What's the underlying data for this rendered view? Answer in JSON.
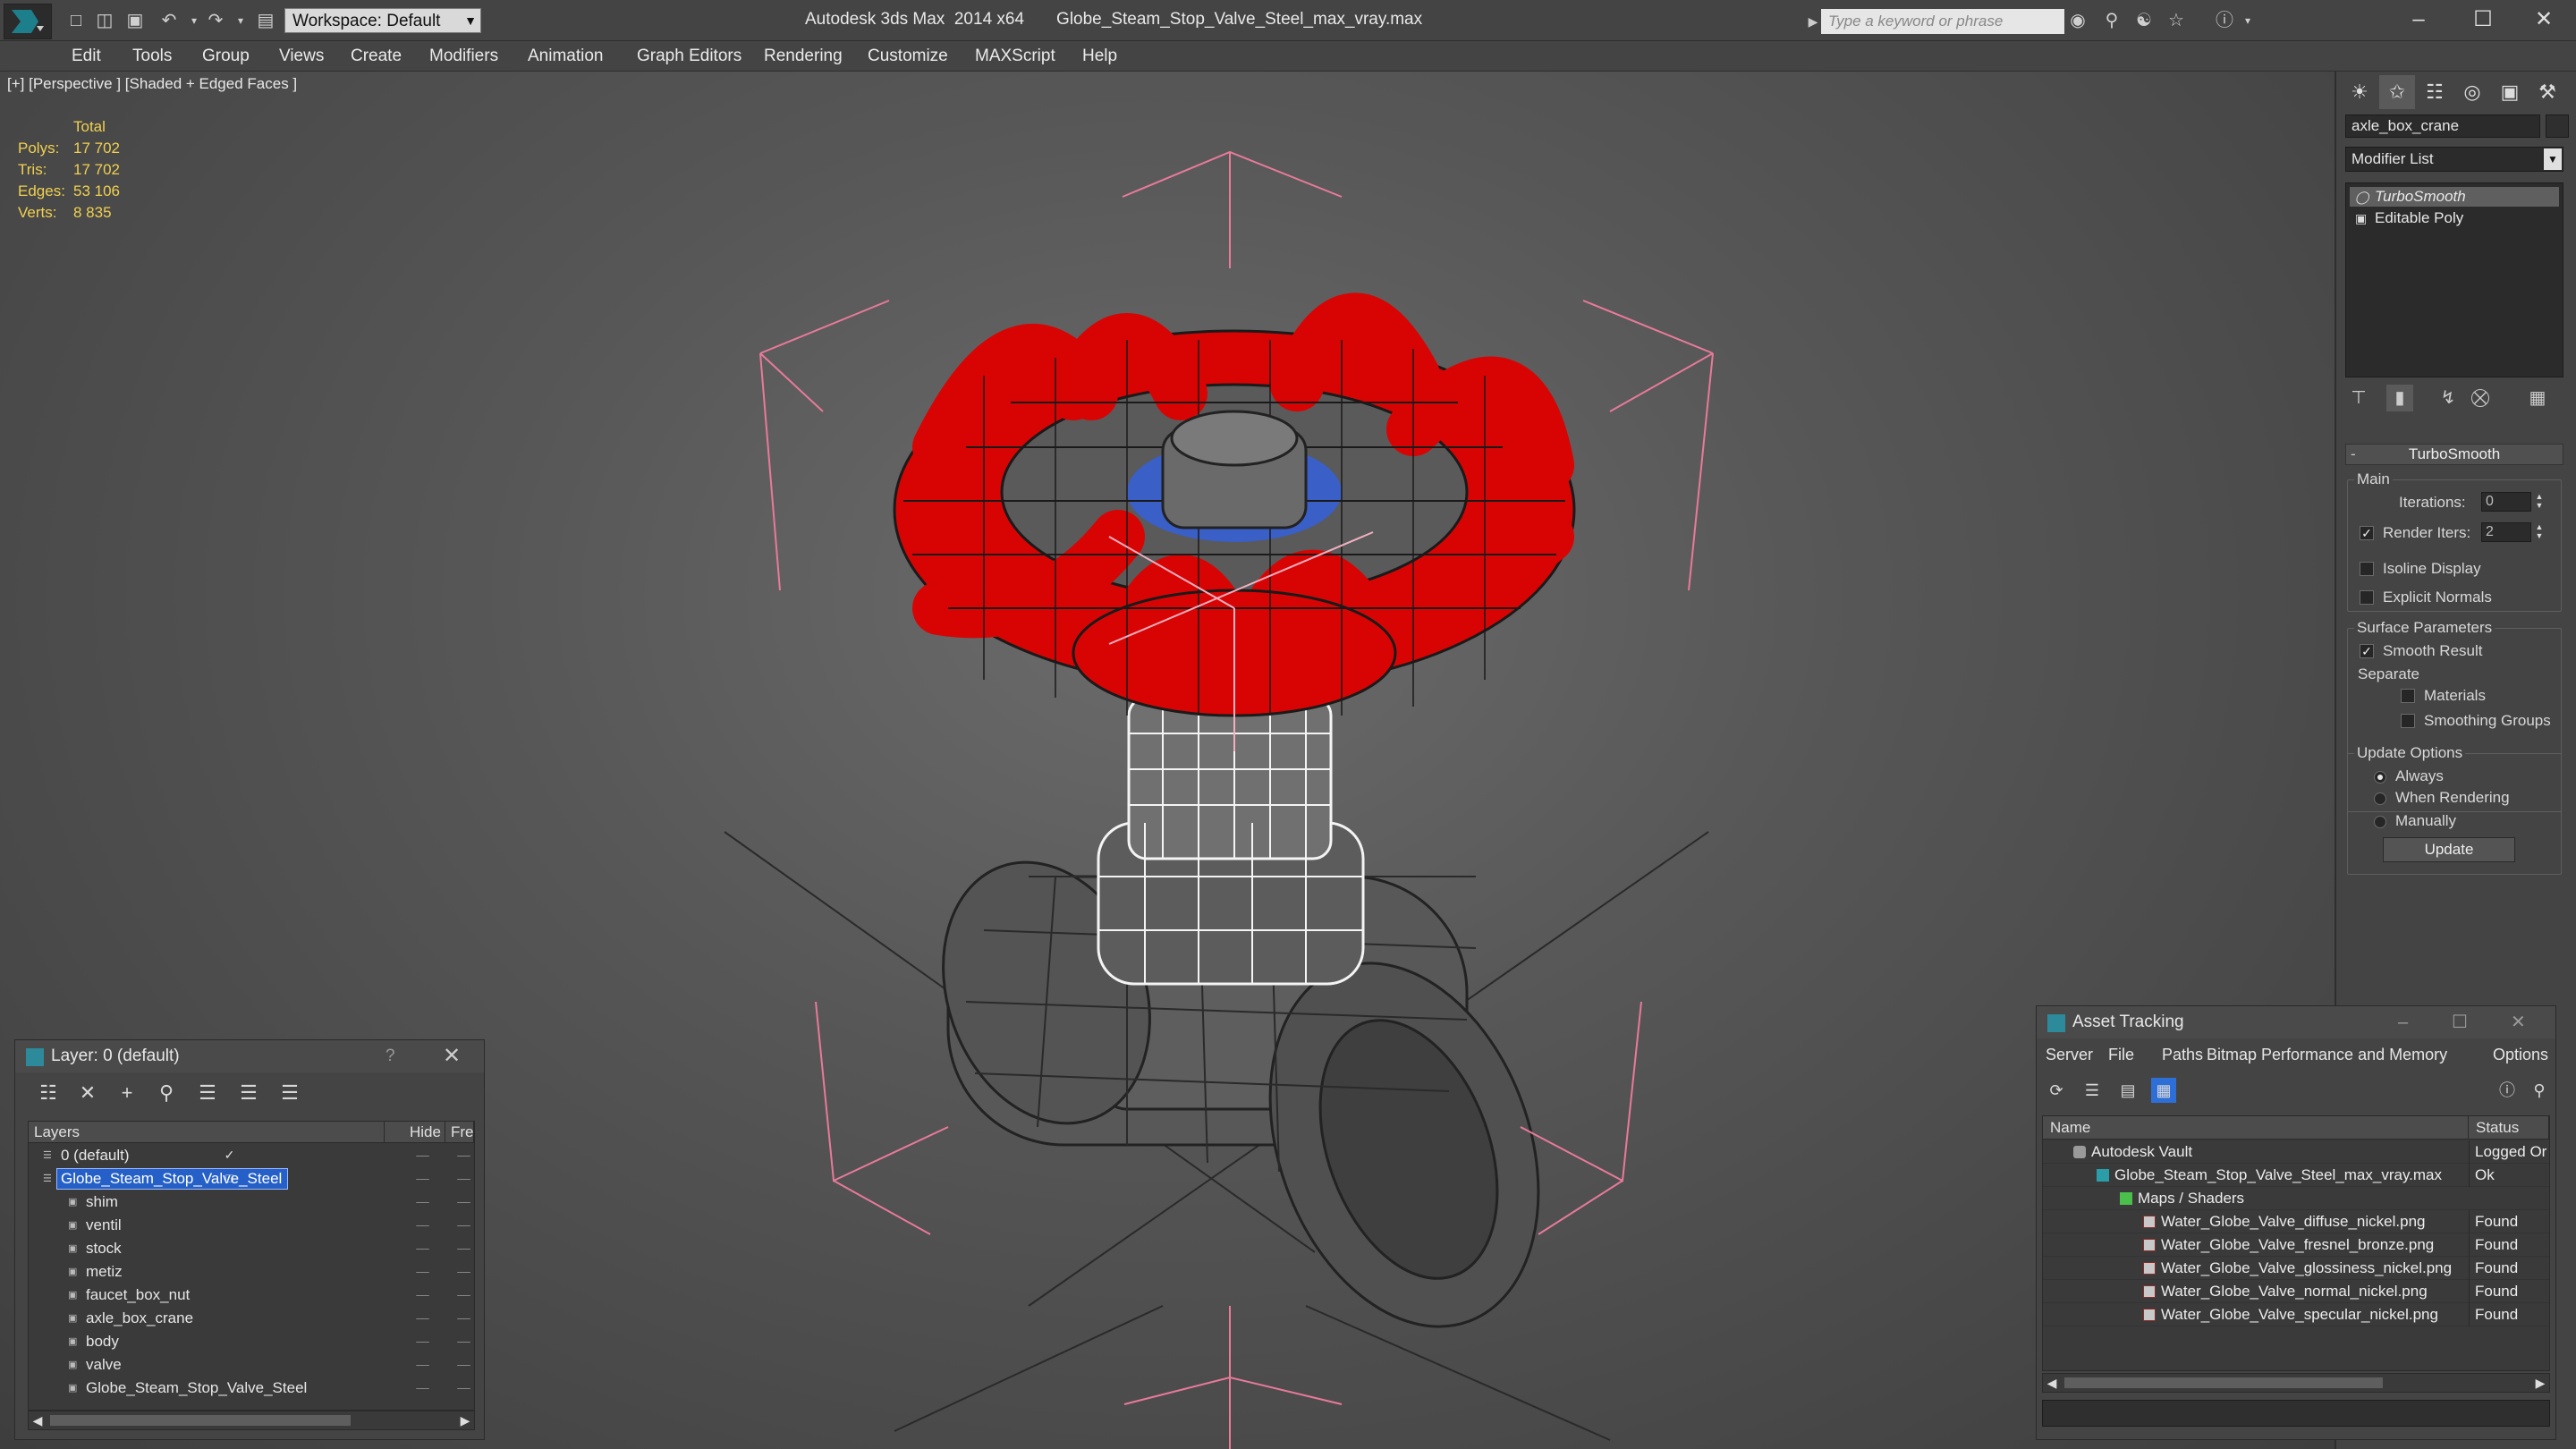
{
  "titlebar": {
    "workspace": "Workspace: Default",
    "app_title": "Autodesk 3ds Max  2014 x64",
    "file_title": "Globe_Steam_Stop_Valve_Steel_max_vray.max",
    "search_placeholder": "Type a keyword or phrase"
  },
  "menu": [
    "Edit",
    "Tools",
    "Group",
    "Views",
    "Create",
    "Modifiers",
    "Animation",
    "Graph Editors",
    "Rendering",
    "Customize",
    "MAXScript",
    "Help"
  ],
  "viewport": {
    "label": "[+] [Perspective ] [Shaded + Edged Faces ]",
    "stats": {
      "header": "Total",
      "rows": [
        {
          "label": "Polys:",
          "value": "17 702"
        },
        {
          "label": "Tris:",
          "value": "17 702"
        },
        {
          "label": "Edges:",
          "value": "53 106"
        },
        {
          "label": "Verts:",
          "value": "8 835"
        }
      ]
    },
    "colors": {
      "handle": "#d80404",
      "wire": "#1a1a1a",
      "body": "#555555",
      "selection": "#ffffff",
      "gizmo": "#e87a9a"
    }
  },
  "command_panel": {
    "object_name": "axle_box_crane",
    "modifier_list": "Modifier List",
    "stack": [
      "TurboSmooth",
      "Editable Poly"
    ],
    "rollout": "TurboSmooth",
    "main_group": "Main",
    "iterations_label": "Iterations:",
    "iterations_value": "0",
    "render_iters_label": "Render Iters:",
    "render_iters_value": "2",
    "isoline": "Isoline Display",
    "explicit": "Explicit Normals",
    "surface_group": "Surface Parameters",
    "smooth_result": "Smooth Result",
    "separate": "Separate",
    "materials": "Materials",
    "smoothing_groups": "Smoothing Groups",
    "update_group": "Update Options",
    "always": "Always",
    "when_rendering": "When Rendering",
    "manually": "Manually",
    "update_button": "Update"
  },
  "layer_panel": {
    "title": "Layer: 0 (default)",
    "help": "?",
    "columns": [
      "Layers",
      "Hide",
      "Free:"
    ],
    "rows": [
      {
        "name": "0 (default)",
        "indent": 0,
        "selected": false,
        "checked": true
      },
      {
        "name": "Globe_Steam_Stop_Valve_Steel",
        "indent": 0,
        "selected": true,
        "checked": false
      },
      {
        "name": "shim",
        "indent": 1
      },
      {
        "name": "ventil",
        "indent": 1
      },
      {
        "name": "stock",
        "indent": 1
      },
      {
        "name": "metiz",
        "indent": 1
      },
      {
        "name": "faucet_box_nut",
        "indent": 1
      },
      {
        "name": "axle_box_crane",
        "indent": 1
      },
      {
        "name": "body",
        "indent": 1
      },
      {
        "name": "valve",
        "indent": 1
      },
      {
        "name": "Globe_Steam_Stop_Valve_Steel",
        "indent": 1
      }
    ]
  },
  "asset_panel": {
    "title": "Asset Tracking",
    "menu": [
      "Server",
      "File",
      "Paths",
      "Bitmap Performance and Memory",
      "Options"
    ],
    "columns": [
      "Name",
      "Status"
    ],
    "rows": [
      {
        "name": "Autodesk Vault",
        "status": "Logged Or",
        "indent": 1,
        "icon": "vault"
      },
      {
        "name": "Globe_Steam_Stop_Valve_Steel_max_vray.max",
        "status": "Ok",
        "indent": 2,
        "icon": "max"
      },
      {
        "name": "Maps / Shaders",
        "status": "",
        "indent": 3,
        "icon": "folder"
      },
      {
        "name": "Water_Globe_Valve_diffuse_nickel.png",
        "status": "Found",
        "indent": 4,
        "icon": "png"
      },
      {
        "name": "Water_Globe_Valve_fresnel_bronze.png",
        "status": "Found",
        "indent": 4,
        "icon": "png"
      },
      {
        "name": "Water_Globe_Valve_glossiness_nickel.png",
        "status": "Found",
        "indent": 4,
        "icon": "png"
      },
      {
        "name": "Water_Globe_Valve_normal_nickel.png",
        "status": "Found",
        "indent": 4,
        "icon": "png"
      },
      {
        "name": "Water_Globe_Valve_specular_nickel.png",
        "status": "Found",
        "indent": 4,
        "icon": "png"
      }
    ]
  }
}
